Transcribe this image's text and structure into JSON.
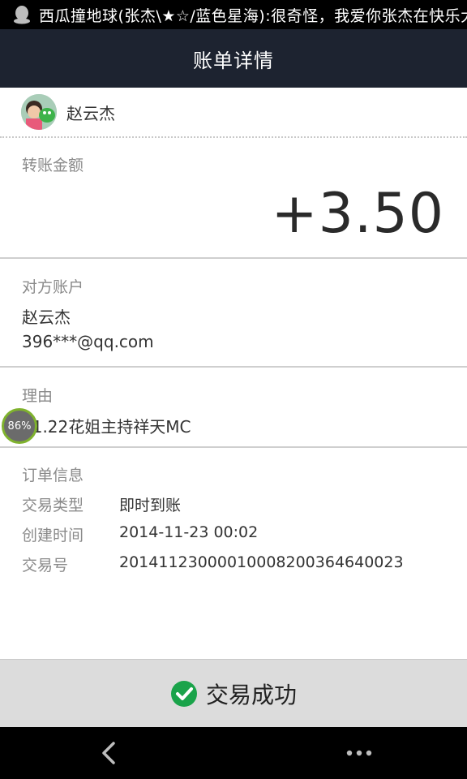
{
  "status_bar": {
    "notification_text": "西瓜撞地球(张杰\\★☆/蓝色星海):很奇怪，我爱你张杰在快乐大"
  },
  "header": {
    "title": "账单详情"
  },
  "payer": {
    "name": "赵云杰"
  },
  "amount_section": {
    "label": "转账金额",
    "amount": "+3.50"
  },
  "counterparty": {
    "label": "对方账户",
    "name": "赵云杰",
    "account": "396***@qq.com"
  },
  "reason": {
    "label": "理由",
    "text": "11.22花姐主持祥天MC"
  },
  "overlay": {
    "progress_text": "86%"
  },
  "order_info": {
    "label": "订单信息",
    "rows": [
      {
        "key": "交易类型",
        "value": "即时到账"
      },
      {
        "key": "创建时间",
        "value": "2014-11-23 00:02"
      },
      {
        "key": "交易号",
        "value": "20141123000010008200364640023"
      }
    ]
  },
  "footer": {
    "status_text": "交易成功",
    "status_color": "#1aa34a"
  },
  "nav": {
    "back_icon": "chevron-left-icon",
    "more_icon": "more-dots-icon"
  }
}
